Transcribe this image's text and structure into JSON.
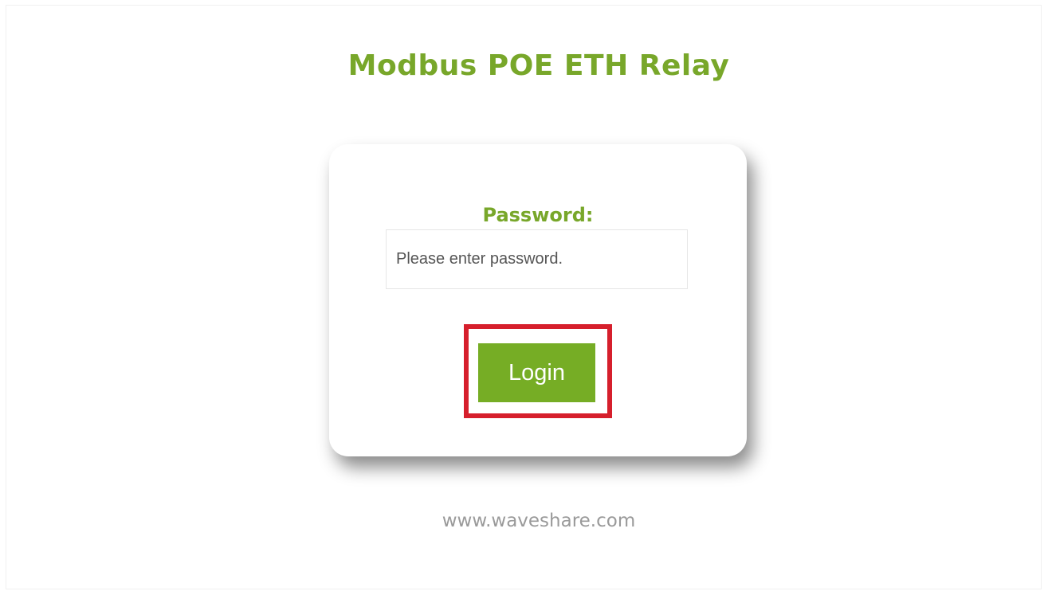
{
  "header": {
    "title": "Modbus POE ETH Relay"
  },
  "login_form": {
    "password_label": "Password:",
    "password_placeholder": "Please enter password.",
    "password_value": "",
    "login_button_label": "Login"
  },
  "annotation": {
    "highlight_color": "#d61f2c"
  },
  "footer": {
    "link_text": "www.waveshare.com"
  },
  "colors": {
    "brand_green": "#78a72a",
    "button_green": "#76ad25"
  }
}
